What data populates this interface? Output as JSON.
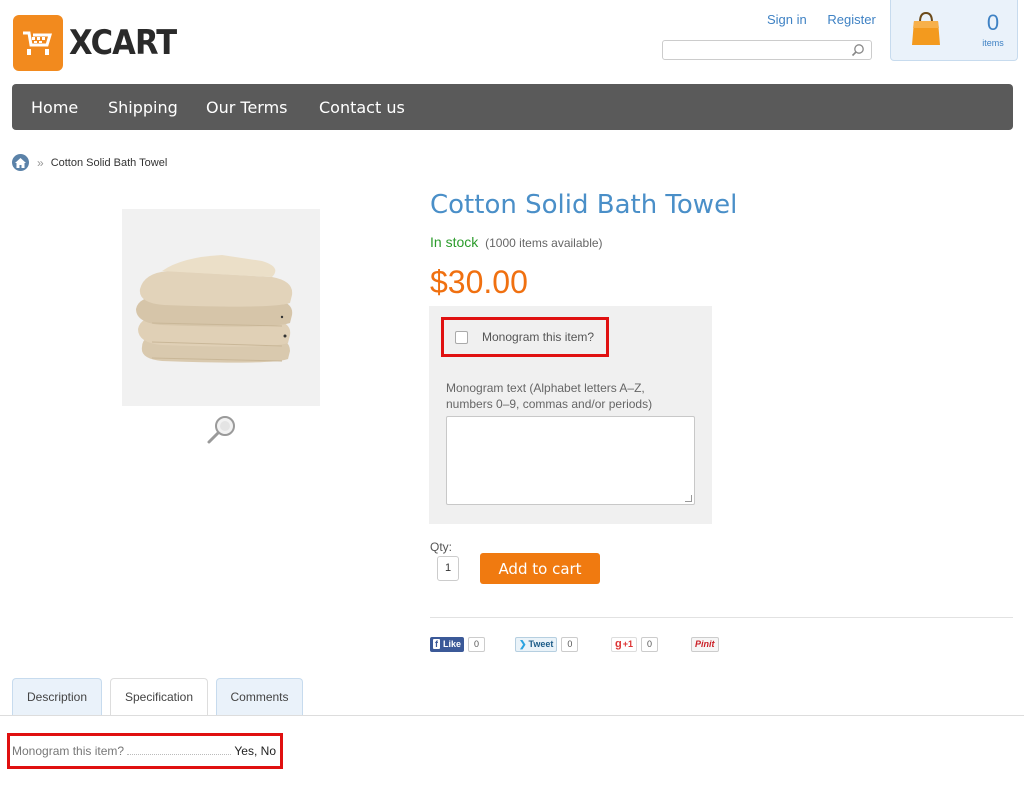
{
  "header": {
    "logo_text": "XCART",
    "signin_label": "Sign in",
    "register_label": "Register",
    "search": {
      "value": "",
      "placeholder": ""
    },
    "cart": {
      "count": "0",
      "label": "items"
    }
  },
  "nav": {
    "items": [
      "Home",
      "Shipping",
      "Our Terms",
      "Contact us"
    ]
  },
  "breadcrumb": {
    "separator": "»",
    "current": "Cotton Solid Bath Towel"
  },
  "product": {
    "title": "Cotton Solid Bath Towel",
    "stock_status": "In stock",
    "stock_detail": "(1000 items available)",
    "price": "$30.00",
    "monogram_checkbox_label": "Monogram this item?",
    "monogram_text_label": "Monogram text (Alphabet letters A–Z, numbers 0–9, commas and/or periods)",
    "monogram_text_value": "",
    "qty_label": "Qty:",
    "qty_value": "1",
    "add_to_cart_label": "Add to cart"
  },
  "social": {
    "facebook": {
      "label": "Like",
      "count": "0"
    },
    "twitter": {
      "label": "Tweet",
      "count": "0"
    },
    "gplus": {
      "label": "+1",
      "count": "0"
    },
    "pinterest": {
      "label": "Pinit"
    }
  },
  "tabs": [
    "Description",
    "Specification",
    "Comments"
  ],
  "specification": {
    "name": "Monogram this item?",
    "value": "Yes, No"
  },
  "colors": {
    "brand_orange": "#f28a1e",
    "link_blue": "#3f82c4",
    "nav_bg": "#5a5a5a",
    "price": "#f07010",
    "in_stock": "#2c9c2c",
    "highlight_red": "#e01010"
  }
}
